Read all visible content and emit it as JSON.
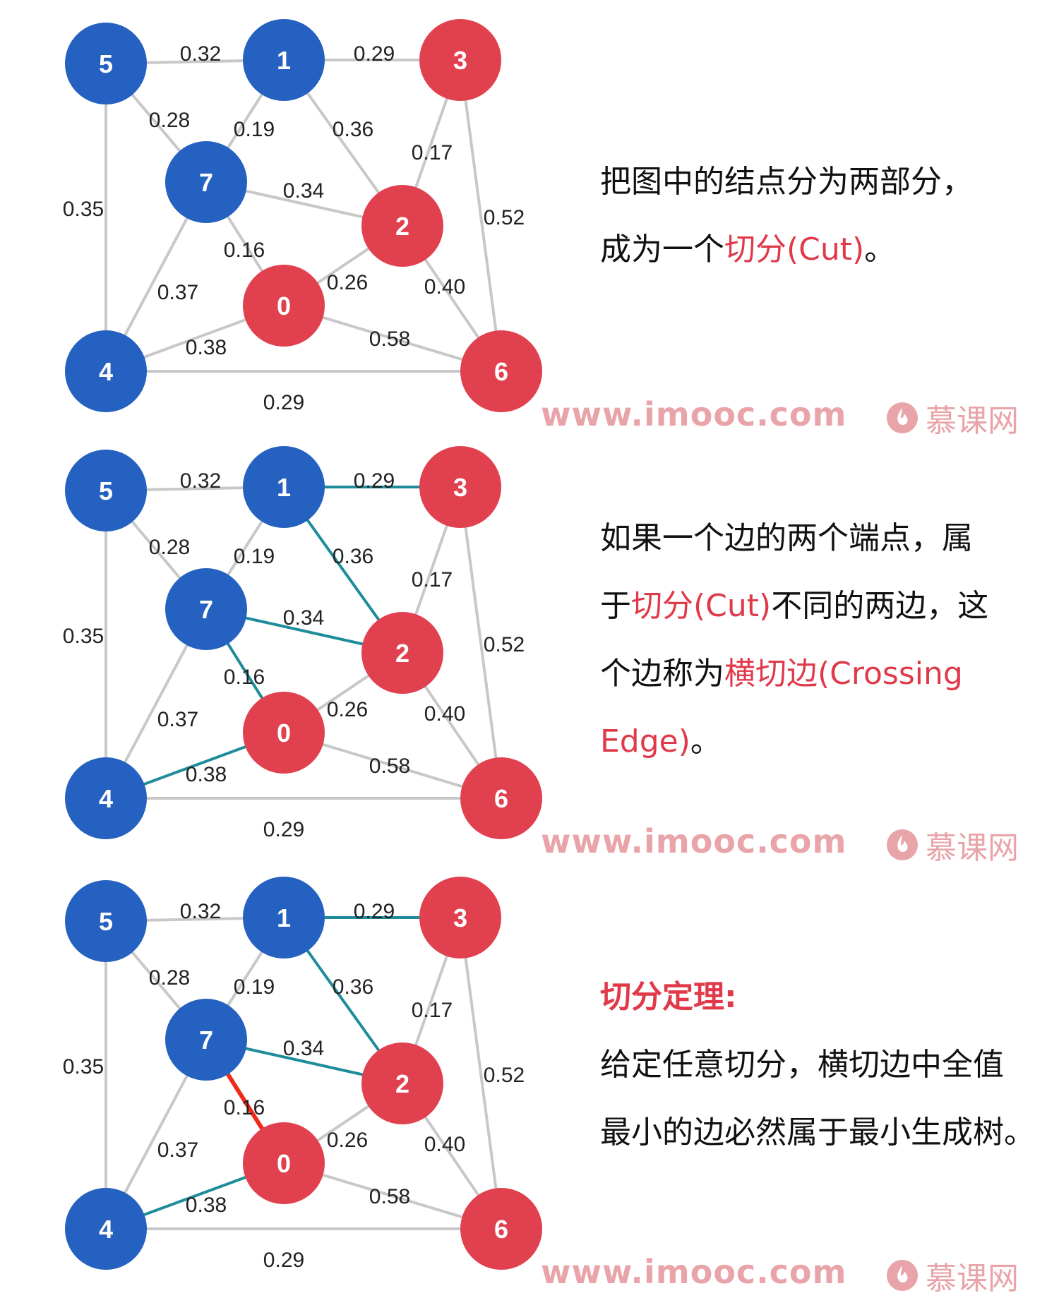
{
  "nodes": [
    {
      "id": "0",
      "side": "red"
    },
    {
      "id": "1",
      "side": "blue"
    },
    {
      "id": "2",
      "side": "red"
    },
    {
      "id": "3",
      "side": "red"
    },
    {
      "id": "4",
      "side": "blue"
    },
    {
      "id": "5",
      "side": "blue"
    },
    {
      "id": "6",
      "side": "red"
    },
    {
      "id": "7",
      "side": "blue"
    }
  ],
  "edges": [
    {
      "from": "5",
      "to": "1",
      "weight": "0.32"
    },
    {
      "from": "1",
      "to": "3",
      "weight": "0.29"
    },
    {
      "from": "5",
      "to": "7",
      "weight": "0.28"
    },
    {
      "from": "1",
      "to": "7",
      "weight": "0.19"
    },
    {
      "from": "1",
      "to": "2",
      "weight": "0.36"
    },
    {
      "from": "3",
      "to": "2",
      "weight": "0.17"
    },
    {
      "from": "5",
      "to": "4",
      "weight": "0.35"
    },
    {
      "from": "7",
      "to": "2",
      "weight": "0.34"
    },
    {
      "from": "3",
      "to": "6",
      "weight": "0.52"
    },
    {
      "from": "7",
      "to": "0",
      "weight": "0.16"
    },
    {
      "from": "0",
      "to": "2",
      "weight": "0.26"
    },
    {
      "from": "7",
      "to": "4",
      "weight": "0.37"
    },
    {
      "from": "2",
      "to": "6",
      "weight": "0.40"
    },
    {
      "from": "4",
      "to": "0",
      "weight": "0.38"
    },
    {
      "from": "0",
      "to": "6",
      "weight": "0.58"
    },
    {
      "from": "4",
      "to": "6",
      "weight": "0.29"
    }
  ],
  "colors": {
    "blue_node": "#2561c0",
    "red_node": "#e1414f",
    "default_edge": "#c8c8c8",
    "crossing_edge": "#1e8c9a",
    "min_crossing_edge": "#ee2a1a",
    "highlight_text": "#e03a4a",
    "watermark": "#e8a4a8"
  },
  "panels": [
    {
      "crossing_edges": [],
      "min_edge": null,
      "text_lines": [
        [
          {
            "t": "把图中的结点分为两部分，"
          }
        ],
        [
          {
            "t": "成为一个"
          },
          {
            "t": "切分(Cut)",
            "hl": true
          },
          {
            "t": "。"
          }
        ]
      ]
    },
    {
      "crossing_edges": [
        1,
        4,
        7,
        9,
        13
      ],
      "min_edge": null,
      "text_lines": [
        [
          {
            "t": "如果一个边的两个端点，属"
          }
        ],
        [
          {
            "t": "于"
          },
          {
            "t": "切分(Cut)",
            "hl": true
          },
          {
            "t": "不同的两边，这"
          }
        ],
        [
          {
            "t": "个边称为"
          },
          {
            "t": "横切边(Crossing",
            "hl": true
          }
        ],
        [
          {
            "t": "Edge)",
            "hl": true
          },
          {
            "t": "。"
          }
        ]
      ]
    },
    {
      "crossing_edges": [
        1,
        4,
        7,
        13
      ],
      "min_edge": 9,
      "text_lines": [
        [
          {
            "t": "切分定理:",
            "title": true
          }
        ],
        [
          {
            "t": "给定任意切分，横切边中全值"
          }
        ],
        [
          {
            "t": "最小的边必然属于最小生成树。"
          }
        ]
      ]
    }
  ],
  "watermark": {
    "url": "www.imooc.com",
    "brand": "慕课网",
    "logo_icon": "flame-icon"
  }
}
